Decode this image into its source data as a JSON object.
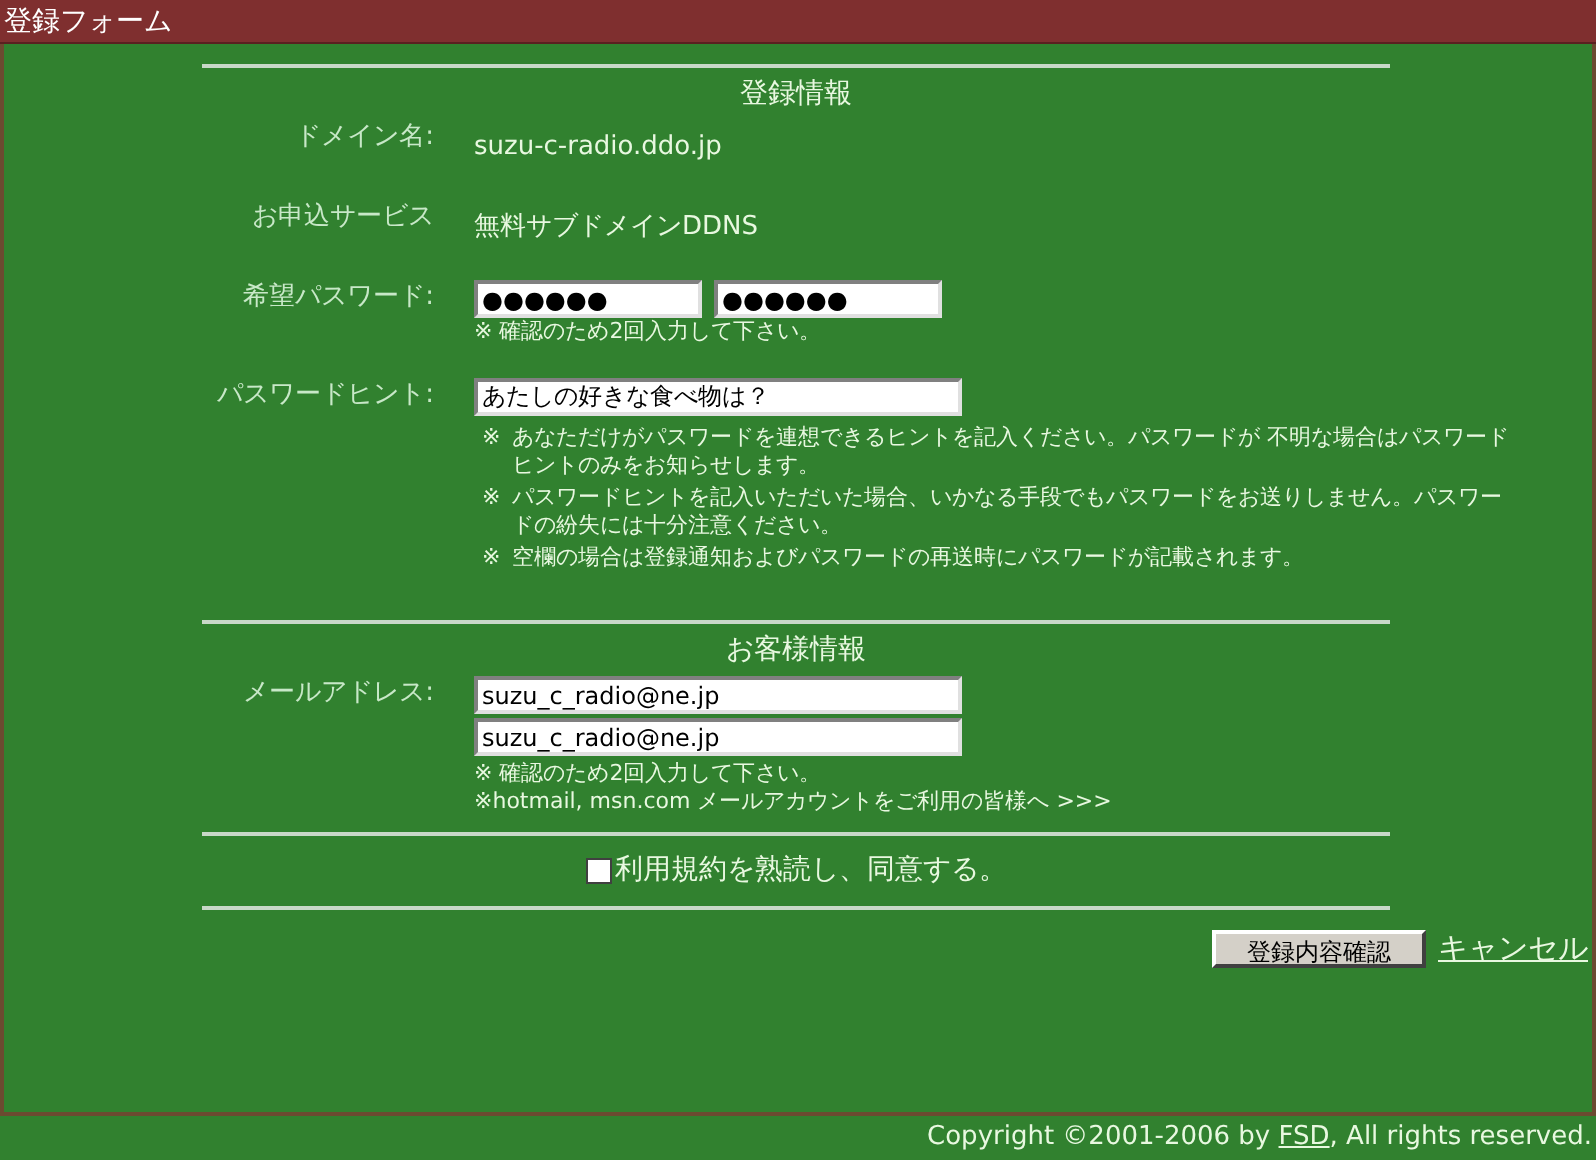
{
  "window": {
    "title": "登録フォーム"
  },
  "sections": [
    {
      "heading": "登録情報",
      "rows": [
        {
          "kind": "text",
          "label": "ドメイン名:",
          "value": "suzu-c-radio.ddo.jp"
        },
        {
          "kind": "text",
          "label": "お申込サービス",
          "value": "無料サブドメインDDNS"
        },
        {
          "kind": "pair",
          "label": "希望パスワード:",
          "values": [
            "●●●●●●",
            "●●●●●●"
          ],
          "notes": [
            "※ 確認のため2回入力して下さい。"
          ]
        },
        {
          "kind": "hint",
          "label": "パスワードヒント:",
          "values": [
            "あたしの好きな食べ物は？"
          ],
          "notes": [
            "あなただけがパスワードを連想できるヒントを記入ください。パスワードが 不明な場合はパスワードヒントのみをお知らせします。",
            "パスワードヒントを記入いただいた場合、いかなる手段でもパスワードをお送りしません。パスワードの紛失には十分注意ください。",
            "空欄の場合は登録通知およびパスワードの再送時にパスワードが記載されます。"
          ],
          "bullet": "※"
        }
      ]
    },
    {
      "heading": "お客様情報",
      "rows": [
        {
          "kind": "stack",
          "label": "メールアドレス:",
          "values": [
            "suzu_c_radio@ne.jp",
            "suzu_c_radio@ne.jp"
          ],
          "notes": [
            "※ 確認のため2回入力して下さい。",
            "※hotmail, msn.com メールアカウントをご利用の皆様へ >>>"
          ]
        }
      ]
    }
  ],
  "agree": {
    "label": "利用規約を熟読し、同意する。",
    "checked": false
  },
  "buttons": {
    "confirm": "登録内容確認",
    "cancel": "キャンセル"
  },
  "footer": {
    "before": "Copyright ©2001-2006 by ",
    "link": "FSD",
    "after": ", All rights reserved."
  }
}
